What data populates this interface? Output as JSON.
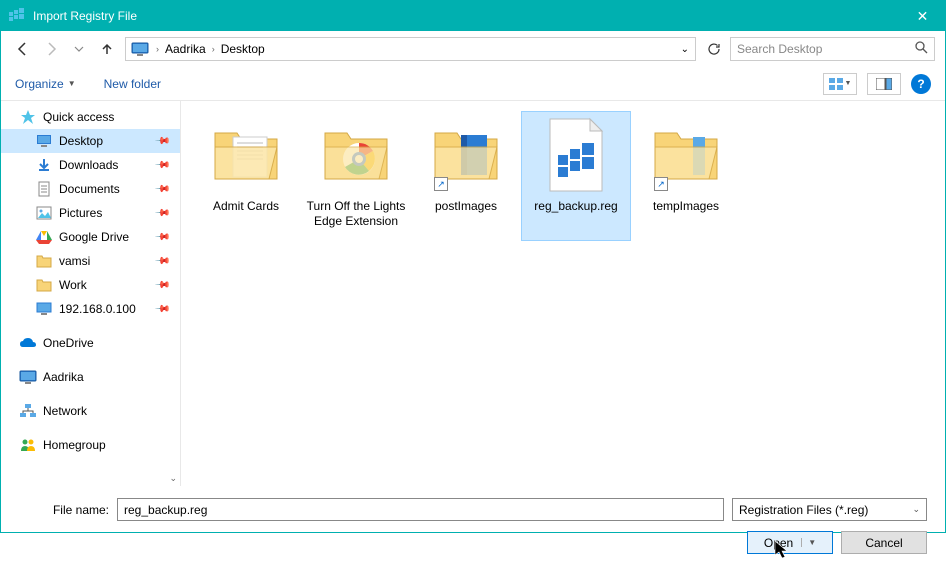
{
  "title": "Import Registry File",
  "breadcrumb": {
    "seg1": "Aadrika",
    "seg2": "Desktop"
  },
  "search_placeholder": "Search Desktop",
  "toolbar": {
    "organize": "Organize",
    "newfolder": "New folder"
  },
  "sidebar": {
    "quick_access": "Quick access",
    "items": [
      {
        "label": "Desktop",
        "pinned": true
      },
      {
        "label": "Downloads",
        "pinned": true
      },
      {
        "label": "Documents",
        "pinned": true
      },
      {
        "label": "Pictures",
        "pinned": true
      },
      {
        "label": "Google Drive",
        "pinned": true
      },
      {
        "label": "vamsi",
        "pinned": true
      },
      {
        "label": "Work",
        "pinned": true
      },
      {
        "label": "192.168.0.100",
        "pinned": true
      }
    ],
    "onedrive": "OneDrive",
    "aadrika": "Aadrika",
    "network": "Network",
    "homegroup": "Homegroup"
  },
  "files": [
    {
      "label": "Admit Cards",
      "type": "folder-doc"
    },
    {
      "label": "Turn Off the Lights Edge Extension",
      "type": "folder-chrome"
    },
    {
      "label": "postImages",
      "type": "shortcut"
    },
    {
      "label": "reg_backup.reg",
      "type": "regfile",
      "selected": true
    },
    {
      "label": "tempImages",
      "type": "shortcut"
    }
  ],
  "filename_label": "File name:",
  "filename_value": "reg_backup.reg",
  "filetype": "Registration Files (*.reg)",
  "buttons": {
    "open": "Open",
    "cancel": "Cancel"
  }
}
